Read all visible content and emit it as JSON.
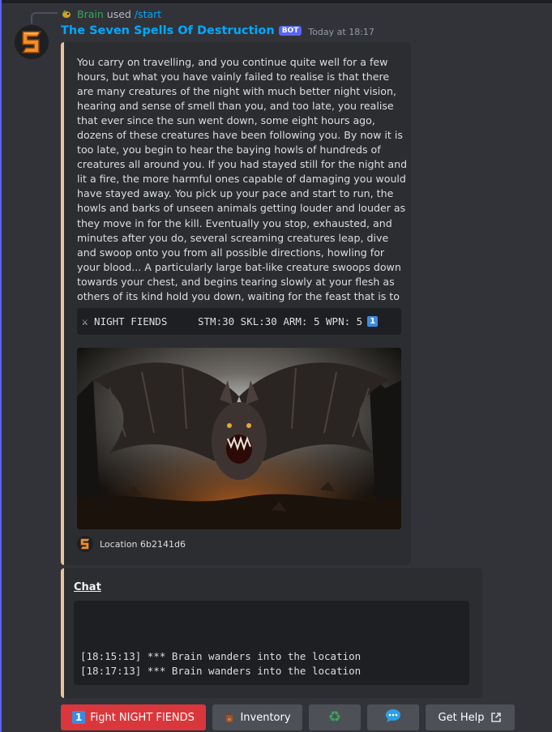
{
  "reply": {
    "user": "Brain",
    "used_label": "used",
    "command": "/start"
  },
  "message": {
    "bot_name": "The Seven Spells Of Destruction",
    "bot_tag": "BOT",
    "timestamp": "Today at 18:17"
  },
  "embed": {
    "description": "You carry on travelling, and you continue quite well for a few hours, but what you have vainly failed to realise is that there are many creatures of the night with much better night vision, hearing and sense of smell than you, and too late, you realise that ever since the sun went down, some eight hours ago, dozens of these creatures have been following you. By now it is too late, you begin to hear the baying howls of hundreds of creatures all around you. If you had stayed still for the night and lit a fire, the more harmful ones capable of damaging you would have stayed away. You pick up your pace and start to run, the howls and barks of unseen animals getting louder and louder as they move in for the kill. Eventually you stop, exhausted, and minutes after you do, several screaming creatures leap, dive and swoop onto you from all possible directions, howling for your blood... A particularly large bat-like creature swoops down towards your chest, and begins tearing slowly at your flesh as others of its kind hold you down, waiting for the feast that is to come...",
    "enemy_line": "⚔ NIGHT FIENDS     STM:30 SKL:30 ARM: 5 WPN: 5",
    "enemy_badge": "1",
    "footer_text": "Location 6b2141d6",
    "accent_color": "#e8c39a"
  },
  "chat_embed": {
    "title": "Chat",
    "log": "[18:15:13] *** Brain wanders into the location\n[18:17:13] *** Brain wanders into the location"
  },
  "buttons": {
    "fight_badge": "1",
    "fight_label": "Fight NIGHT FIENDS",
    "inventory_label": "Inventory",
    "help_label": "Get Help",
    "recycle_icon": "recycle-icon",
    "chat_icon": "speech-bubble-icon"
  },
  "colors": {
    "blurple": "#5865f2",
    "link": "#00a8fc",
    "danger": "#da373c",
    "secondary": "#4e5058"
  }
}
